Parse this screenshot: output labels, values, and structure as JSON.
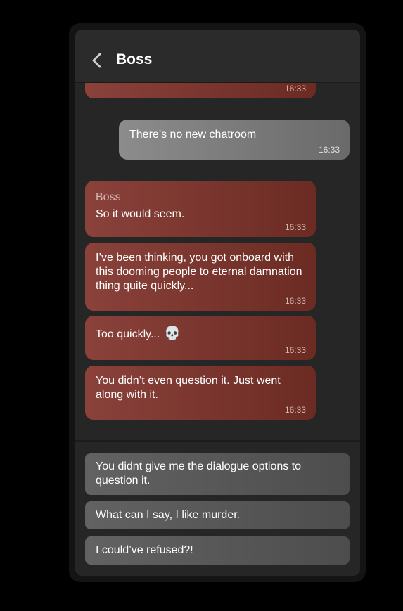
{
  "header": {
    "title": "Boss",
    "back_icon": "chevron-left-icon"
  },
  "messages": [
    {
      "side": "in",
      "text": "",
      "time": "16:33"
    },
    {
      "side": "out",
      "text": "There’s no new chatroom",
      "time": "16:33"
    },
    {
      "side": "in",
      "sender": "Boss",
      "text": "So it would seem.",
      "time": "16:33"
    },
    {
      "side": "in",
      "text": "I’ve been thinking, you got onboard with this dooming people to eternal damnation thing quite quickly...",
      "time": "16:33"
    },
    {
      "side": "in",
      "text": "Too quickly...",
      "emoji": "💀",
      "time": "16:33"
    },
    {
      "side": "in",
      "text": "You didn’t even question it. Just went along with it.",
      "time": "16:33"
    }
  ],
  "options": [
    "You didnt give me the dialogue options to question it.",
    "What can I say, I like murder.",
    "I could’ve refused?!"
  ]
}
